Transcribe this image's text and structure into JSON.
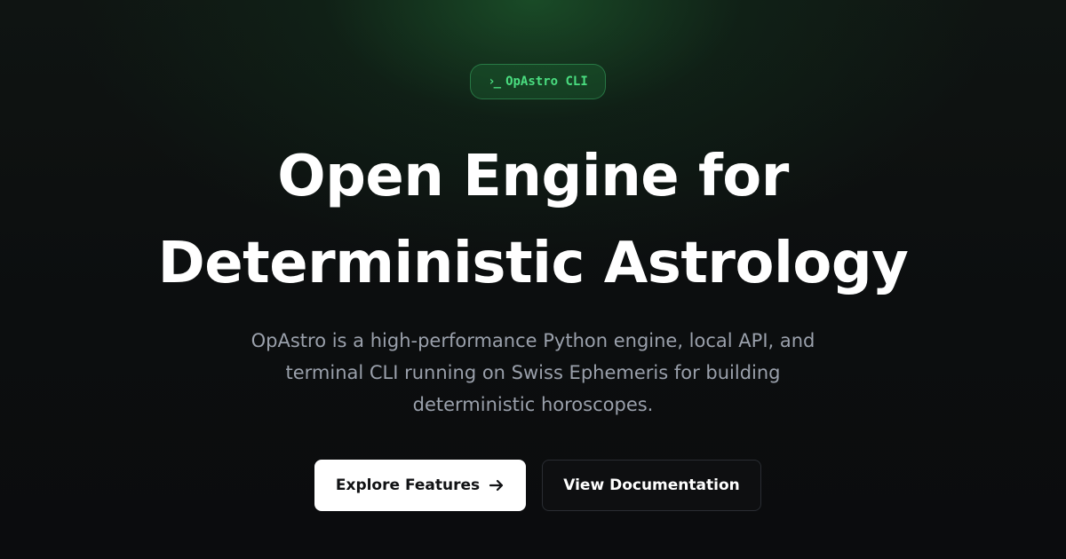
{
  "badge": {
    "icon": "terminal-prompt-icon",
    "icon_glyph": "›_",
    "label": "OpAstro CLI"
  },
  "headline": {
    "line1": "Open Engine for",
    "line2": "Deterministic Astrology"
  },
  "subtitle": {
    "line1": "OpAstro is a high-performance Python engine, local API, and",
    "line2": "terminal CLI running on Swiss Ephemeris for building",
    "line3": "deterministic horoscopes."
  },
  "buttons": {
    "primary_label": "Explore Features",
    "primary_icon": "arrow-right-icon",
    "secondary_label": "View Documentation"
  },
  "colors": {
    "accent": "#4ade80",
    "background": "#0b0c0e",
    "primary_button_bg": "#ffffff",
    "subtitle_text": "#9aa0ab"
  }
}
